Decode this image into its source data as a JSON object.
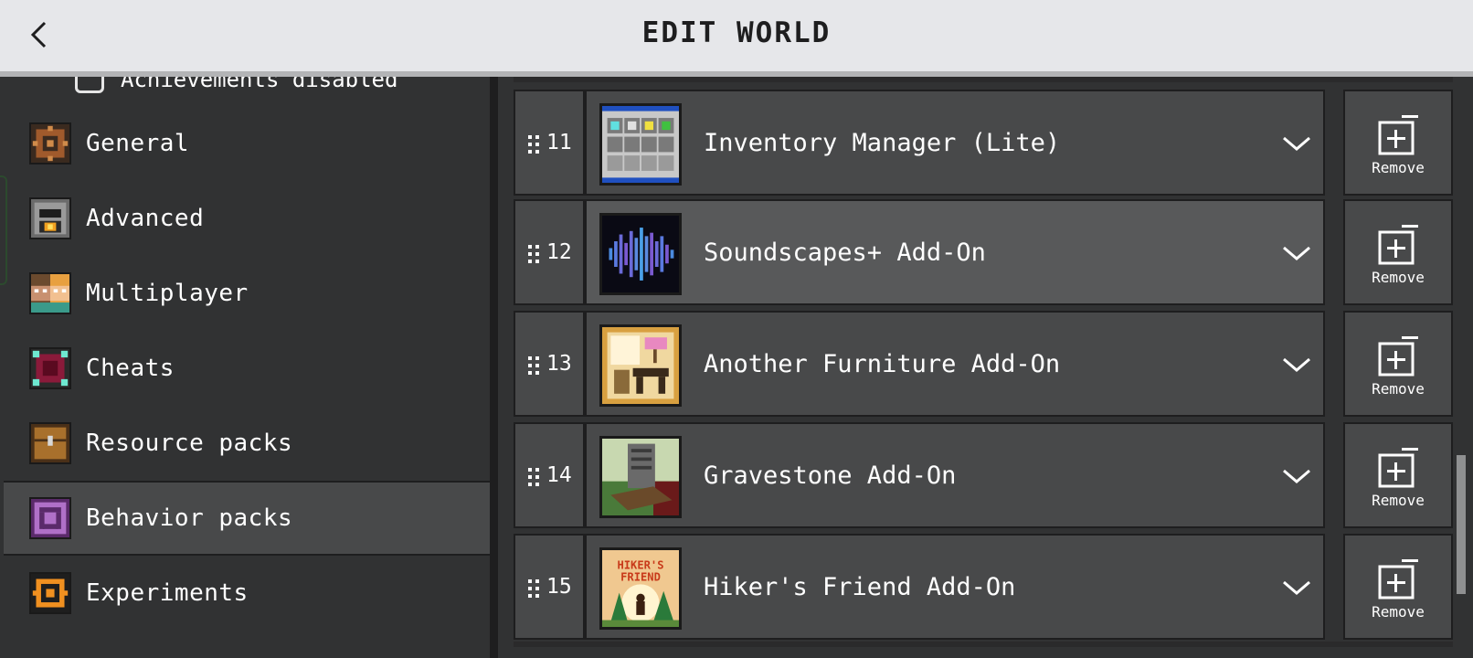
{
  "header": {
    "title": "EDIT WORLD"
  },
  "sidebar": {
    "partial_item": {
      "label": "Achievements disabled"
    },
    "items": [
      {
        "label": "General",
        "icon": "gear-icon"
      },
      {
        "label": "Advanced",
        "icon": "furnace-icon"
      },
      {
        "label": "Multiplayer",
        "icon": "players-icon"
      },
      {
        "label": "Cheats",
        "icon": "cheats-icon"
      },
      {
        "label": "Resource packs",
        "icon": "chest-icon"
      },
      {
        "label": "Behavior packs",
        "icon": "behavior-pack-icon",
        "selected": true
      },
      {
        "label": "Experiments",
        "icon": "experiments-icon"
      }
    ]
  },
  "packs": [
    {
      "number": "11",
      "name": "Inventory Manager (Lite)",
      "icon": "inventory-pack-icon",
      "remove_label": "Remove"
    },
    {
      "number": "12",
      "name": "Soundscapes+ Add-On",
      "icon": "soundwave-pack-icon",
      "remove_label": "Remove",
      "highlighted": true
    },
    {
      "number": "13",
      "name": "Another Furniture Add-On",
      "icon": "furniture-pack-icon",
      "remove_label": "Remove"
    },
    {
      "number": "14",
      "name": "Gravestone Add-On",
      "icon": "gravestone-pack-icon",
      "remove_label": "Remove"
    },
    {
      "number": "15",
      "name": "Hiker's Friend Add-On",
      "icon": "hikers-friend-pack-icon",
      "remove_label": "Remove",
      "icon_text": "HIKER'S FRIEND"
    }
  ],
  "colors": {
    "header_bg": "#e6e7ea",
    "panel_bg": "#313233",
    "row_bg": "#48494a",
    "row_hover_bg": "#58595a",
    "border": "#1e1e1f"
  }
}
